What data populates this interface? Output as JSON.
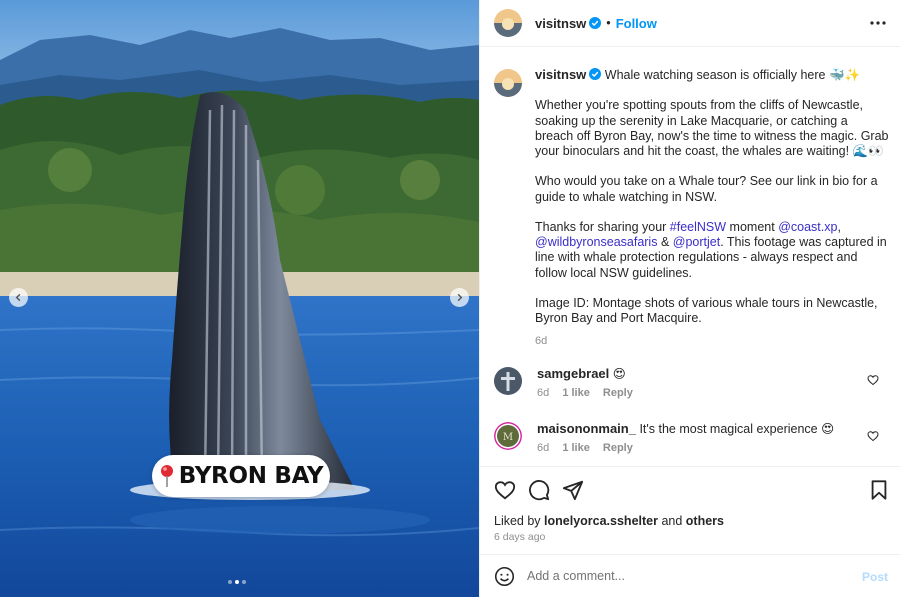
{
  "header": {
    "username": "visitnsw",
    "separator": "•",
    "follow_label": "Follow"
  },
  "media": {
    "location_label": "BYRON BAY",
    "carousel_total": 3,
    "carousel_active": 2
  },
  "caption": {
    "username": "visitnsw",
    "headline": "Whale watching season is officially here 🐳✨",
    "paragraph1": "Whether you're spotting spouts from the cliffs of Newcastle, soaking up the serenity in Lake Macquarie, or catching a breach off Byron Bay, now's the time to witness the magic. Grab your binoculars and hit the coast, the whales are waiting! 🌊👀",
    "paragraph2": "Who would you take on a Whale tour? See our link in bio for a guide to whale watching in NSW.",
    "p3_a": "Thanks for sharing your ",
    "p3_hashtag": "#feelNSW",
    "p3_b": " moment ",
    "p3_mention1": "@coast.xp",
    "p3_c": ",",
    "p3_mention2": "@wildbyronseasafaris",
    "p3_d": " & ",
    "p3_mention3": "@portjet",
    "p3_e": ". This footage was captured in line with whale protection regulations - always respect and follow local NSW guidelines.",
    "paragraph4": "Image ID: Montage shots of various whale tours in Newcastle, Byron Bay and Port Macquire.",
    "time": "6d"
  },
  "comments": [
    {
      "username": "samgebrael",
      "text": "😍",
      "time": "6d",
      "likes": "1 like",
      "reply": "Reply"
    },
    {
      "username": "maisononmain_",
      "text": "It's the most magical experience 😍",
      "time": "6d",
      "likes": "1 like",
      "reply": "Reply"
    }
  ],
  "likes": {
    "prefix": "Liked by ",
    "user": "lonelyorca.sshelter",
    "middle": " and ",
    "others": "others"
  },
  "posted_ago": "6 days ago",
  "add_comment": {
    "placeholder": "Add a comment...",
    "post_label": "Post"
  },
  "colors": {
    "link_blue": "#0095f6",
    "hashtag": "#3a2ec9",
    "verified": "#0095f6",
    "muted": "#8e8e8e"
  },
  "icons": [
    "verified-badge-icon",
    "more-options-icon",
    "heart-icon",
    "comment-icon",
    "share-icon",
    "bookmark-icon",
    "emoji-icon",
    "location-pin-icon",
    "chevron-left-icon",
    "chevron-right-icon"
  ]
}
